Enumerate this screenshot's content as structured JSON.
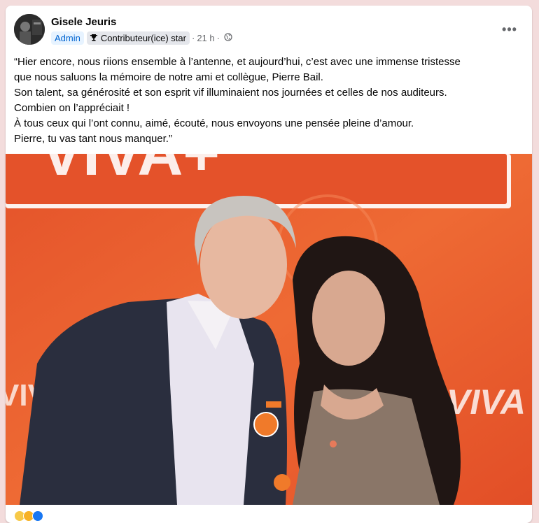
{
  "post": {
    "author": "Gisele Jeuris",
    "badge_admin": "Admin",
    "badge_star": "Contributeur(ice) star",
    "time": "21 h",
    "separator": "·",
    "more_label": "•••",
    "text_lines": [
      "“Hier encore, nous riions ensemble à l’antenne, et aujourd’hui, c’est avec une immense tristesse",
      "que nous saluons la mémoire de notre ami et collègue, Pierre Bail.",
      "Son talent, sa générosité et son esprit vif illuminaient nos journées et celles de nos auditeurs.",
      "Combien on l’appréciait !",
      "À tous ceux qui l’ont connu, aimé, écouté, nous envoyons une pensée pleine d’amour.",
      "Pierre, tu vas tant nous manquer.”"
    ]
  },
  "photo": {
    "banner_text": "VIVA+",
    "side_text_left": "VIVA",
    "side_text_right": "VIVA"
  },
  "colors": {
    "page_bg": "#f3dcdc",
    "photo_orange": "#e8552a",
    "admin_blue": "#0064d1"
  }
}
